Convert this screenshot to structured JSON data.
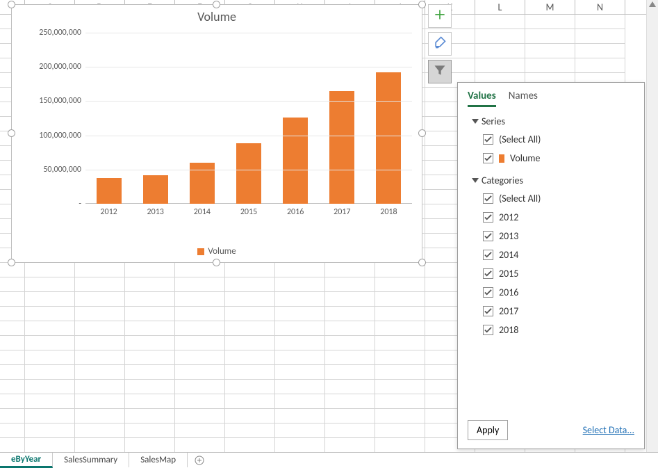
{
  "columns": [
    "C",
    "D",
    "E",
    "F",
    "G",
    "H",
    "I",
    "J",
    "K",
    "L",
    "M",
    "N"
  ],
  "chart_data": {
    "type": "bar",
    "title": "Volume",
    "categories": [
      "2012",
      "2013",
      "2014",
      "2015",
      "2016",
      "2017",
      "2018"
    ],
    "values": [
      38000000,
      42000000,
      60000000,
      88000000,
      126000000,
      165000000,
      192000000
    ],
    "ylabel": "",
    "xlabel": "",
    "ylim": [
      0,
      250000000
    ],
    "yticks": [
      "-",
      "50,000,000",
      "100,000,000",
      "150,000,000",
      "200,000,000",
      "250,000,000"
    ],
    "legend": "Volume"
  },
  "flyout": {
    "tabs": {
      "values": "Values",
      "names": "Names"
    },
    "series_label": "Series",
    "series_select_all": "(Select All)",
    "series_items": [
      "Volume"
    ],
    "categories_label": "Categories",
    "categories_select_all": "(Select All)",
    "category_items": [
      "2012",
      "2013",
      "2014",
      "2015",
      "2016",
      "2017",
      "2018"
    ],
    "apply": "Apply",
    "select_data": "Select Data..."
  },
  "sheets": {
    "active": "eByYear",
    "tabs": [
      "eByYear",
      "SalesSummary",
      "SalesMap"
    ]
  }
}
